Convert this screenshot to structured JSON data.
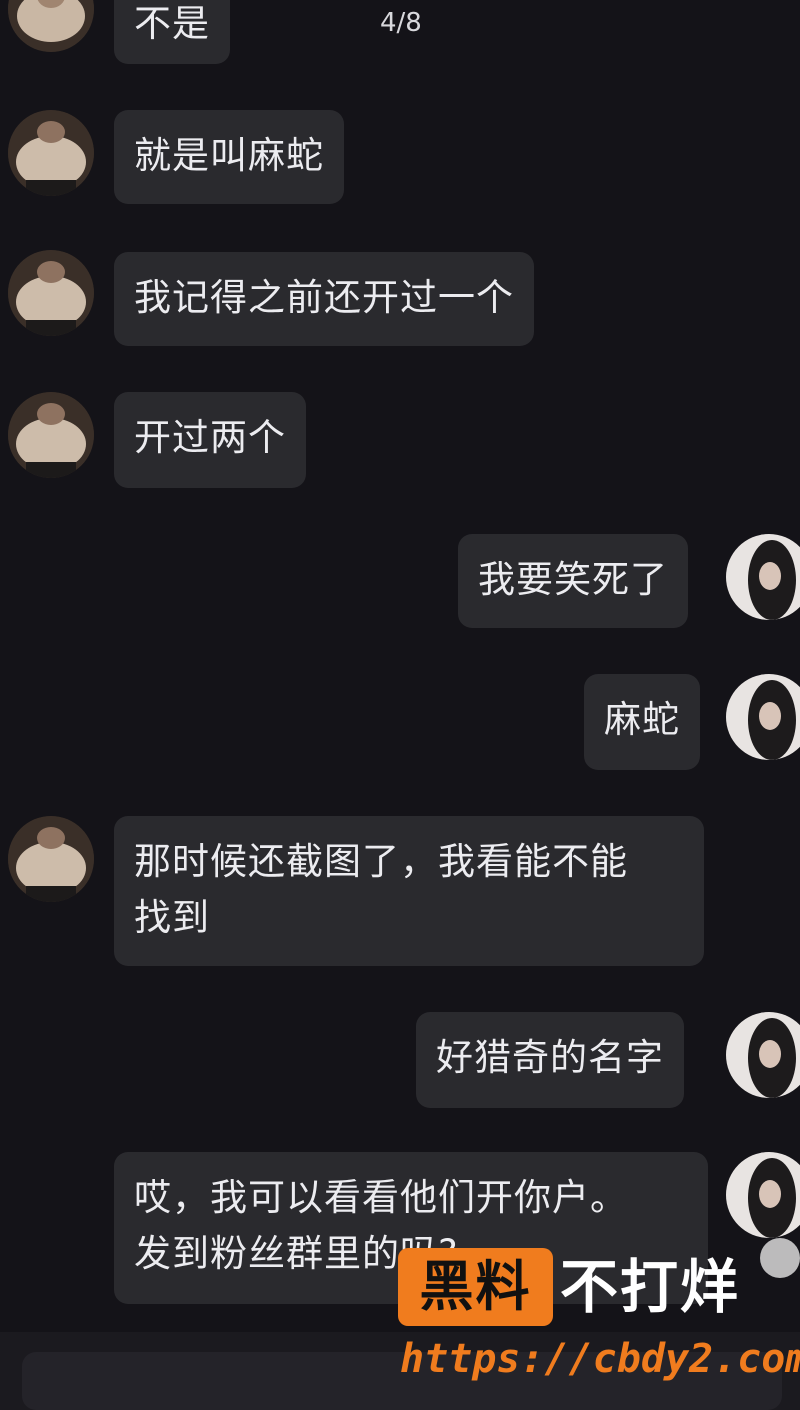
{
  "header": {
    "close_icon": "close-icon",
    "counter": "4/8"
  },
  "messages": [
    {
      "side": "left",
      "text": "不是"
    },
    {
      "side": "left",
      "text": "就是叫麻蛇"
    },
    {
      "side": "left",
      "text": "我记得之前还开过一个"
    },
    {
      "side": "left",
      "text": "开过两个"
    },
    {
      "side": "right",
      "text": "我要笑死了"
    },
    {
      "side": "right",
      "text": "麻蛇"
    },
    {
      "side": "left",
      "line1": "那时候还截图了，我看能不能",
      "line2": "找到"
    },
    {
      "side": "right",
      "text": "好猎奇的名字"
    },
    {
      "side": "left",
      "line1": "哎，我可以看看他们开你户。",
      "line2": "发到粉丝群里的吗?"
    }
  ],
  "watermark": {
    "badge": "黑料",
    "text": "不打烊",
    "url": "https://cbdy2.com"
  },
  "colors": {
    "background": "#141318",
    "bubble": "#2a2a2e",
    "watermark_accent": "#f07c1e"
  }
}
